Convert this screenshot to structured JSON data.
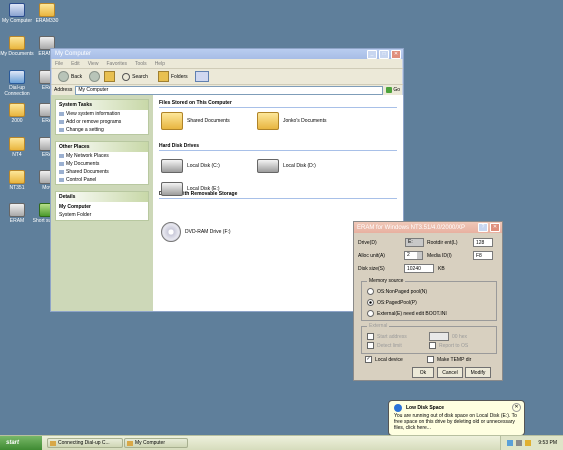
{
  "desktop": {
    "icons": [
      {
        "label": "My Computer",
        "icon": "computer-icon"
      },
      {
        "label": "ERAM330",
        "icon": "folder-icon"
      },
      {
        "label": "My Documents",
        "icon": "folder-icon"
      },
      {
        "label": "ERAM_",
        "icon": "folder-icon"
      },
      {
        "label": "Dial-up Connection",
        "icon": "network-icon"
      },
      {
        "label": "ERA",
        "icon": "folder-icon"
      },
      {
        "label": "2000",
        "icon": "folder-icon"
      },
      {
        "label": "ERA",
        "icon": "folder-icon"
      },
      {
        "label": "NT4",
        "icon": "folder-icon"
      },
      {
        "label": "ERA",
        "icon": "folder-icon"
      },
      {
        "label": "NT351",
        "icon": "folder-icon"
      },
      {
        "label": "Mov",
        "icon": "program-icon"
      },
      {
        "label": "ERAM",
        "icon": "program-icon"
      },
      {
        "label": "Short super_",
        "icon": "shortcut-icon"
      }
    ]
  },
  "explorer": {
    "title": "My Computer",
    "menu": [
      "File",
      "Edit",
      "View",
      "Favorites",
      "Tools",
      "Help"
    ],
    "toolbar": {
      "back": "Back",
      "search": "Search",
      "folders": "Folders"
    },
    "address_label": "Address",
    "address_value": "My Computer",
    "go_label": "Go",
    "system_tasks": {
      "title": "System Tasks",
      "items": [
        "View system information",
        "Add or remove programs",
        "Change a setting"
      ]
    },
    "other_places": {
      "title": "Other Places",
      "items": [
        "My Network Places",
        "My Documents",
        "Shared Documents",
        "Control Panel"
      ]
    },
    "details": {
      "title": "Details",
      "name": "My Computer",
      "type": "System Folder"
    },
    "sections": {
      "files": "Files Stored on This Computer",
      "disks": "Hard Disk Drives",
      "removable": "Devices with Removable Storage"
    },
    "files_items": [
      "Shared Documents",
      "Jonko's Documents"
    ],
    "disk_items": [
      "Local Disk (C:)",
      "Local Disk (D:)",
      "Local Disk (E:)"
    ],
    "removable_items": [
      "DVD-RAM Drive (F:)"
    ]
  },
  "eram": {
    "title": "ERAM for Windows NT3.51/4.0/2000/XP",
    "drive_label": "Drive(D)",
    "drive_value": "E:",
    "rootdir_label": "Rootdir ent(L)",
    "rootdir_value": "128",
    "alloc_label": "Alloc unit(A)",
    "alloc_value": "2",
    "media_label": "Media ID(I)",
    "media_value": "F8",
    "disksize_label": "Disk size(S)",
    "disksize_value": "10240",
    "disksize_unit": "KB",
    "memory_group": "Memory source",
    "mem_options": [
      "OS:NonPaged pool(N)",
      "OS:PagedPool(P)",
      "External(E)   need edit BOOT.INI"
    ],
    "mem_selected": 1,
    "external_group": "External",
    "start_address_label": "Start address",
    "start_address_unit": "00 hex",
    "detect_limit_label": "Detect limit",
    "report_label": "Report to OS",
    "local_device_label": "Local device",
    "temp_dir_label": "Make TEMP dir",
    "ok_label": "Ok",
    "cancel_label": "Cancel",
    "modify_label": "Modify"
  },
  "balloon": {
    "title": "Low Disk Space",
    "text": "You are running out of disk space on Local Disk (E:). To free space on this drive by deleting old or unnecessary files, click here..."
  },
  "taskbar": {
    "start_label": "start",
    "tasks": [
      "Connecting Dial-up C...",
      "My Computer"
    ],
    "clock": "9:53 PM"
  }
}
